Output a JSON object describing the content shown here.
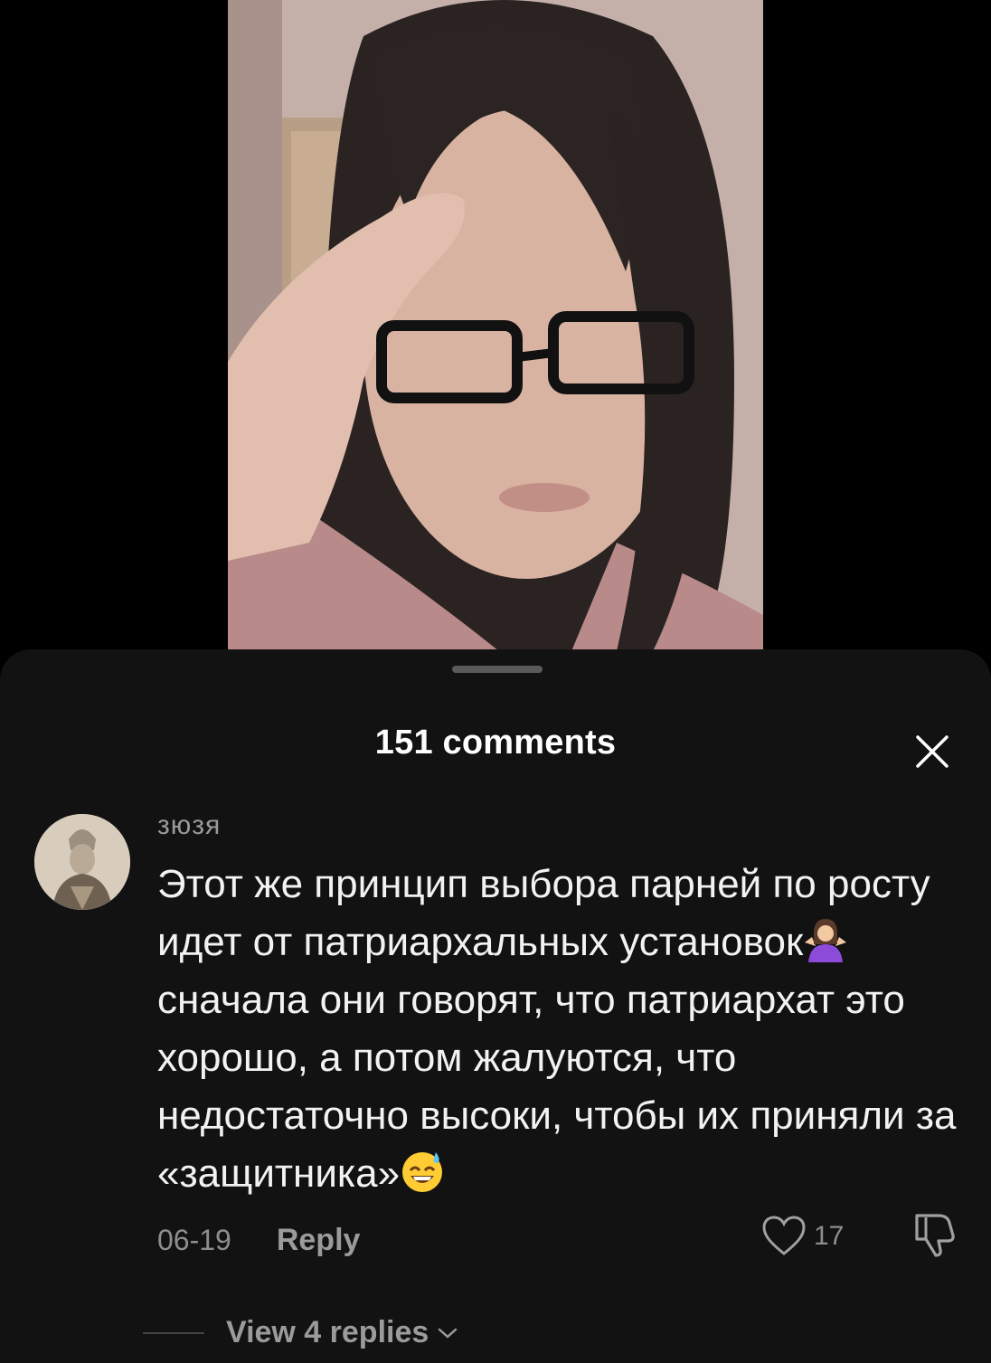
{
  "sheet": {
    "title": "151 comments"
  },
  "comment": {
    "username": "зюзя",
    "text_part1": "Этот же принцип выбора парней по росту идет от патриархальных установок",
    "text_part2": "сначала они говорят, что патриархат это хорошо, а потом жалуются, что недостаточно высоки, чтобы их приняли за «защитника»",
    "emoji_1": "person-shrugging-icon",
    "emoji_2": "grinning-sweat-icon",
    "date": "06-19",
    "reply_label": "Reply",
    "like_count": "17",
    "view_replies_label": "View 4 replies"
  },
  "colors": {
    "sheet_bg": "#121212",
    "page_bg": "#000000",
    "muted_text": "#9b9b9b"
  }
}
